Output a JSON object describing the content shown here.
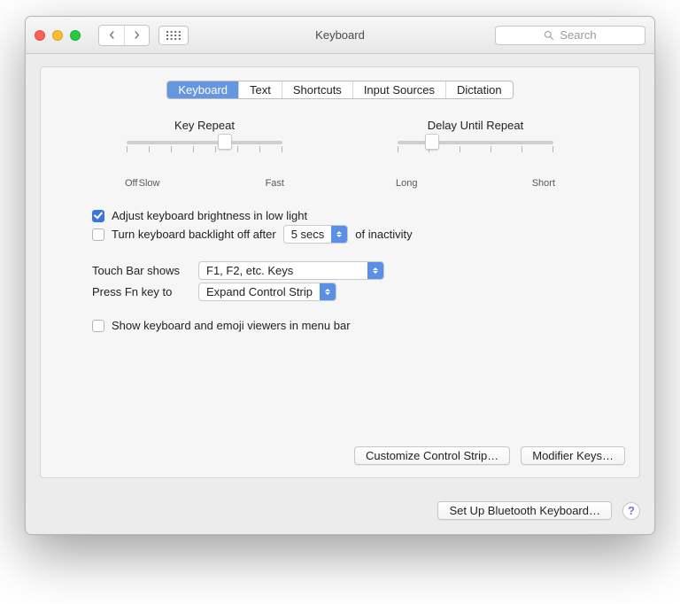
{
  "window": {
    "title": "Keyboard"
  },
  "toolbar": {
    "search_placeholder": "Search"
  },
  "tabs": [
    "Keyboard",
    "Text",
    "Shortcuts",
    "Input Sources",
    "Dictation"
  ],
  "active_tab_index": 0,
  "sliders": {
    "key_repeat": {
      "title": "Key Repeat",
      "labels": [
        "Off",
        "Slow",
        "Fast"
      ],
      "ticks": 8,
      "value_pct": 63
    },
    "delay_until_repeat": {
      "title": "Delay Until Repeat",
      "labels": [
        "Long",
        "Short"
      ],
      "ticks": 6,
      "value_pct": 22
    }
  },
  "options": {
    "adjust_brightness_label": "Adjust keyboard brightness in low light",
    "adjust_brightness_checked": true,
    "backlight_off_label_pre": "Turn keyboard backlight off after",
    "backlight_off_label_post": "of inactivity",
    "backlight_off_checked": false,
    "backlight_off_value": "5 secs",
    "touch_bar_label": "Touch Bar shows",
    "touch_bar_value": "F1, F2, etc. Keys",
    "fn_key_label": "Press Fn key to",
    "fn_key_value": "Expand Control Strip",
    "show_viewers_label": "Show keyboard and emoji viewers in menu bar",
    "show_viewers_checked": false
  },
  "buttons": {
    "customize_strip": "Customize Control Strip…",
    "modifier_keys": "Modifier Keys…",
    "setup_bt_keyboard": "Set Up Bluetooth Keyboard…"
  },
  "help": "?"
}
